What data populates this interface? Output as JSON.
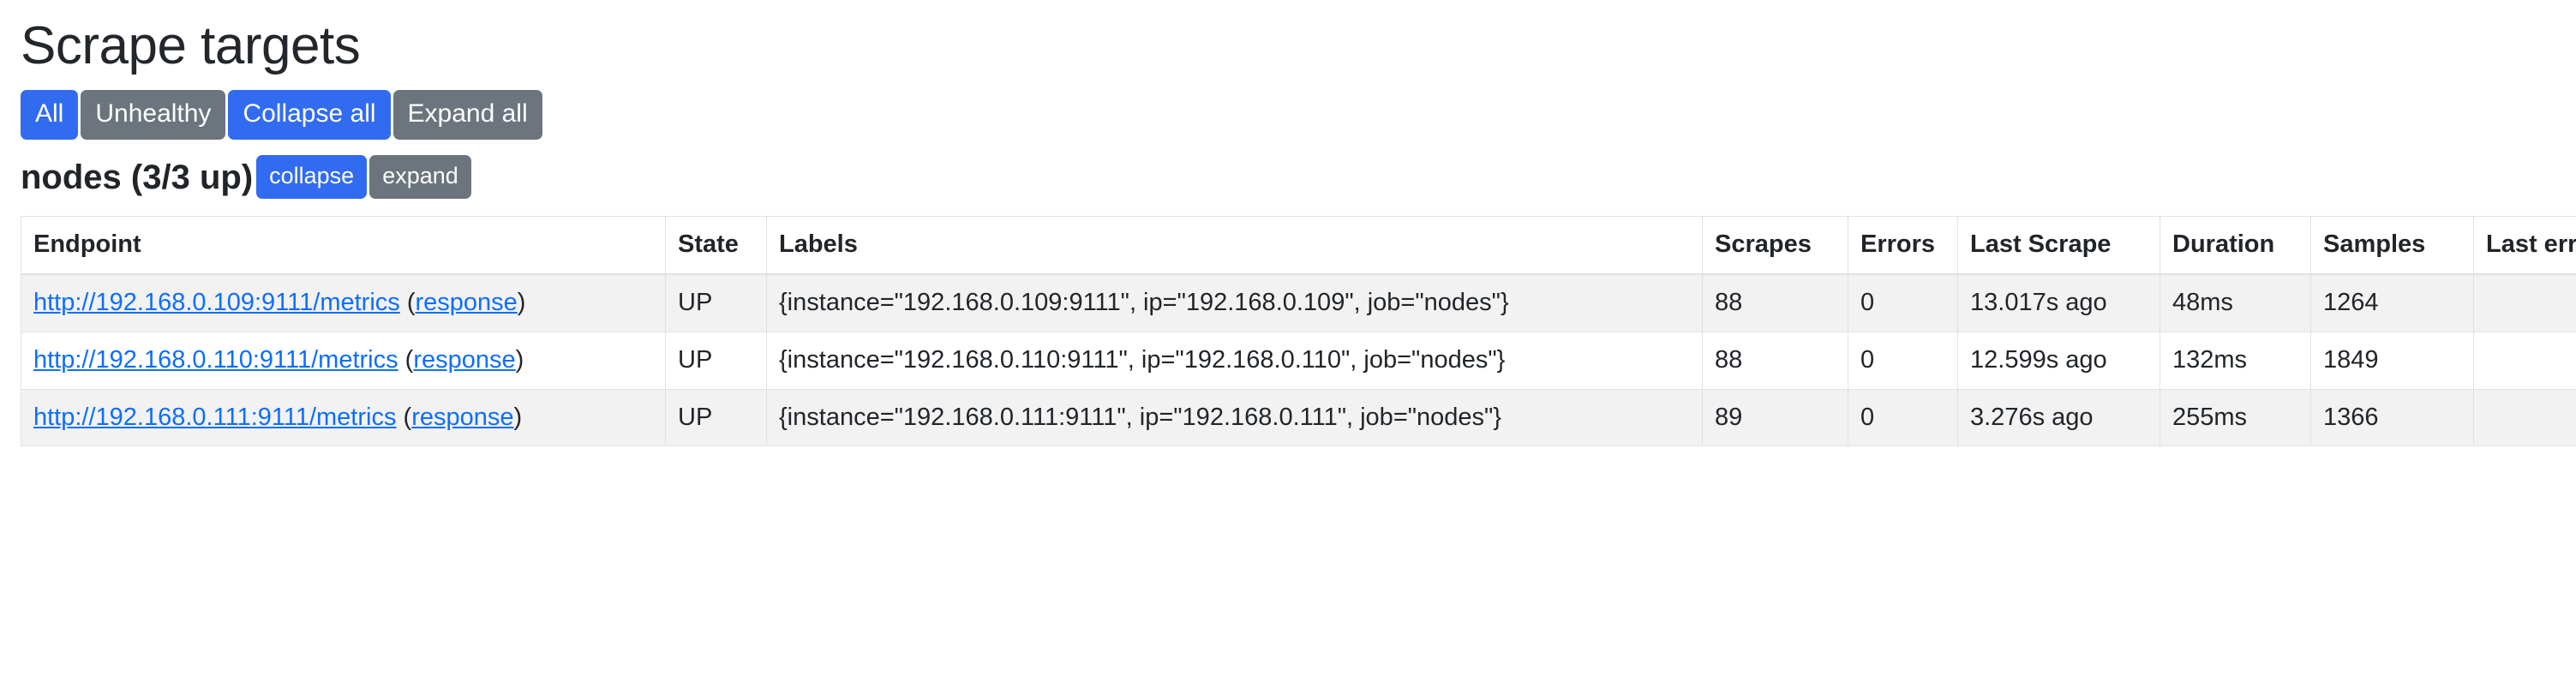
{
  "page": {
    "title": "Scrape targets"
  },
  "filters": {
    "buttons": [
      {
        "label": "All",
        "style": "primary",
        "name": "filter-all-button"
      },
      {
        "label": "Unhealthy",
        "style": "secondary",
        "name": "filter-unhealthy-button"
      },
      {
        "label": "Collapse all",
        "style": "primary",
        "name": "collapse-all-button"
      },
      {
        "label": "Expand all",
        "style": "secondary",
        "name": "expand-all-button"
      }
    ]
  },
  "job": {
    "title": "nodes (3/3 up)",
    "name": "nodes",
    "up": 3,
    "total": 3,
    "collapse_label": "collapse",
    "expand_label": "expand"
  },
  "table": {
    "headers": [
      "Endpoint",
      "State",
      "Labels",
      "Scrapes",
      "Errors",
      "Last Scrape",
      "Duration",
      "Samples",
      "Last error"
    ],
    "rows": [
      {
        "endpoint_url": "http://192.168.0.109:9111/metrics",
        "response_label": "response",
        "state": "UP",
        "labels": "{instance=\"192.168.0.109:9111\", ip=\"192.168.0.109\", job=\"nodes\"}",
        "scrapes": "88",
        "errors": "0",
        "last_scrape": "13.017s ago",
        "duration": "48ms",
        "samples": "1264",
        "last_error": ""
      },
      {
        "endpoint_url": "http://192.168.0.110:9111/metrics",
        "response_label": "response",
        "state": "UP",
        "labels": "{instance=\"192.168.0.110:9111\", ip=\"192.168.0.110\", job=\"nodes\"}",
        "scrapes": "88",
        "errors": "0",
        "last_scrape": "12.599s ago",
        "duration": "132ms",
        "samples": "1849",
        "last_error": ""
      },
      {
        "endpoint_url": "http://192.168.0.111:9111/metrics",
        "response_label": "response",
        "state": "UP",
        "labels": "{instance=\"192.168.0.111:9111\", ip=\"192.168.0.111\", job=\"nodes\"}",
        "scrapes": "89",
        "errors": "0",
        "last_scrape": "3.276s ago",
        "duration": "255ms",
        "samples": "1366",
        "last_error": ""
      }
    ]
  },
  "colors": {
    "primary": "#316bf0",
    "secondary": "#6c757d",
    "link": "#0d6efd",
    "stripe": "#f2f2f2",
    "border": "#dee2e6",
    "text": "#212529"
  }
}
